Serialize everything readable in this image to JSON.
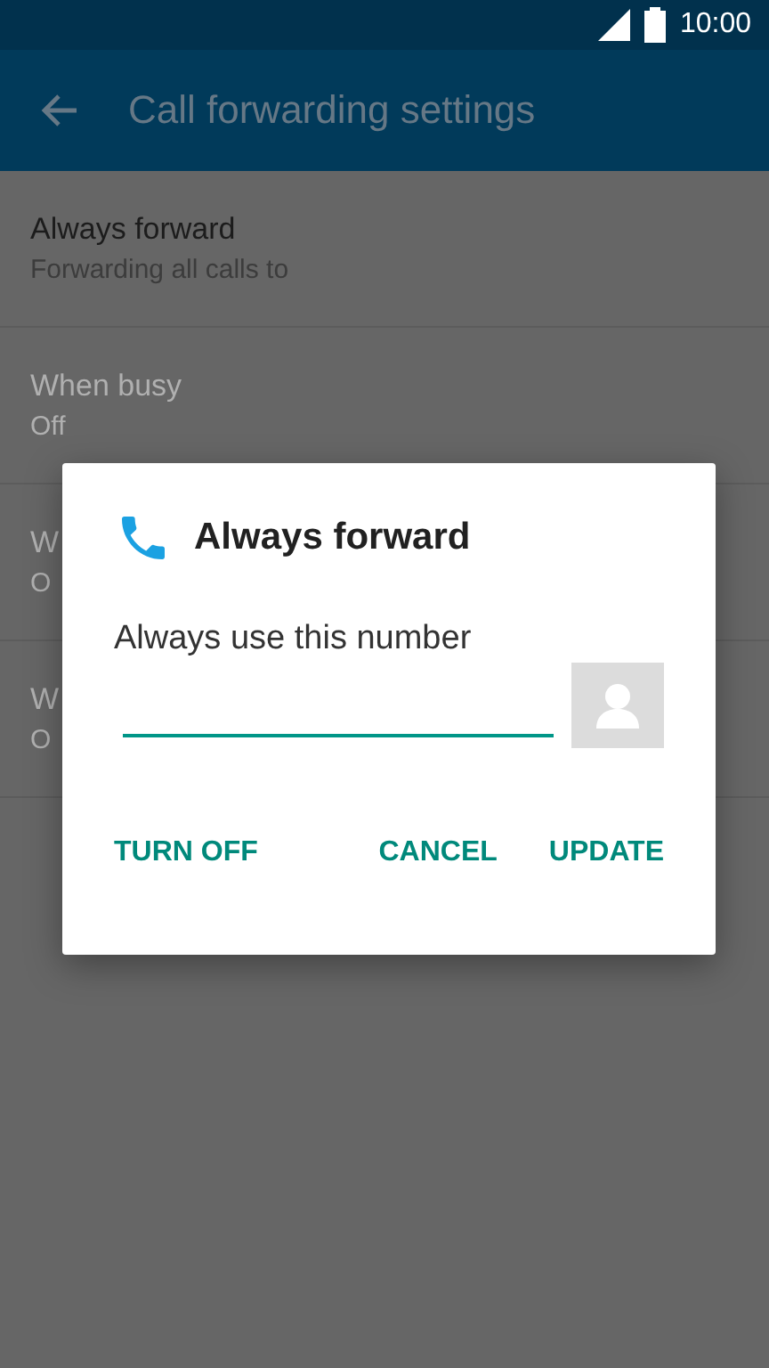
{
  "status_bar": {
    "time": "10:00"
  },
  "app_bar": {
    "title": "Call forwarding settings"
  },
  "settings": [
    {
      "title": "Always forward",
      "summary": "Forwarding all calls to",
      "disabled": false
    },
    {
      "title": "When busy",
      "summary": "Off",
      "disabled": true
    },
    {
      "title": "W",
      "summary": "O",
      "disabled": true
    },
    {
      "title": "W",
      "summary": "O",
      "disabled": true
    }
  ],
  "dialog": {
    "title": "Always forward",
    "label": "Always use this number",
    "actions": [
      {
        "label": "TURN OFF"
      },
      {
        "label": "CANCEL"
      },
      {
        "label": "UPDATE"
      }
    ]
  }
}
